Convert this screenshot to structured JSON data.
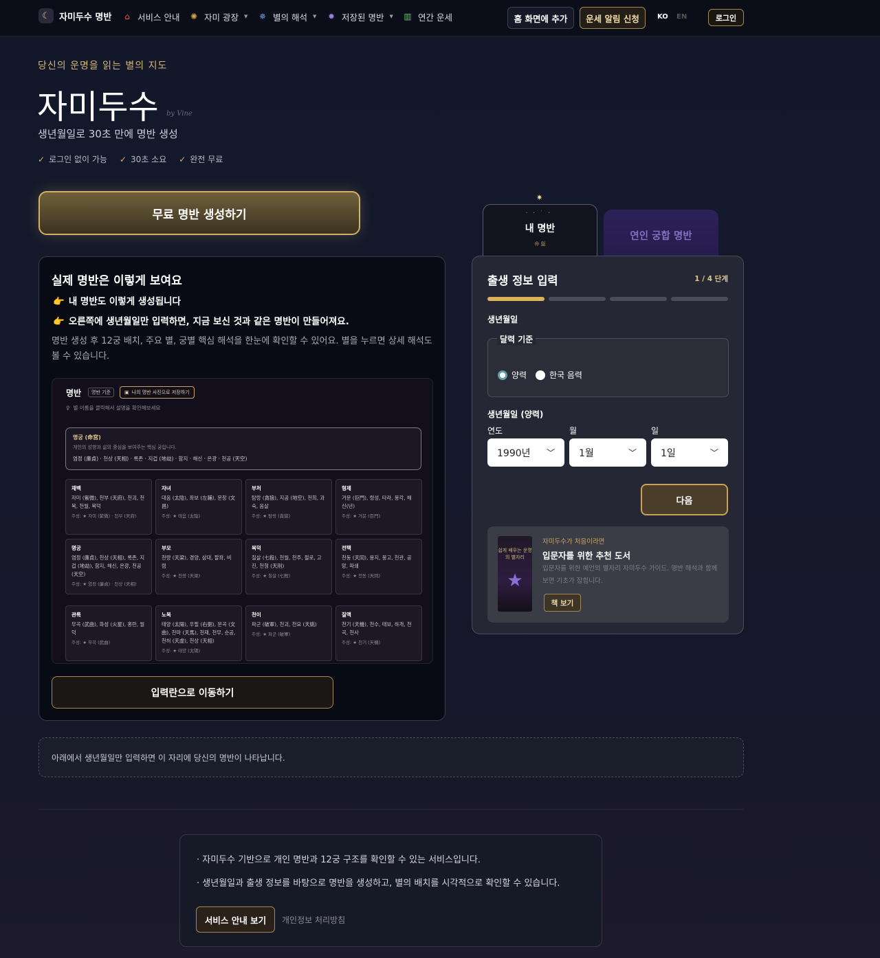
{
  "nav": {
    "logo_label": "자미두수 명반",
    "items": [
      {
        "label": "서비스 안내",
        "icon": "home-icon"
      },
      {
        "label": "자미 광장",
        "icon": "plaza-icon"
      },
      {
        "label": "별의 해석",
        "icon": "galaxy-icon"
      },
      {
        "label": "저장된 명반",
        "icon": "saved-icon"
      },
      {
        "label": "연간 운세",
        "icon": "chart-icon"
      }
    ],
    "add_home": "홈 화면에 추가",
    "alert": "운세 알림 신청",
    "lang_ko": "KO",
    "lang_en": "EN",
    "login": "로그인"
  },
  "hero": {
    "tagline": "당신의 운명을 읽는 별의 지도",
    "title": "자미두수",
    "by": "by Vine",
    "desc": "생년월일로 30초 만에 명반 생성",
    "checks": [
      "로그인 없이 가능",
      "30초 소요",
      "완전 무료"
    ],
    "cta": "무료 명반 생성하기"
  },
  "preview": {
    "title": "실제 명반은 이렇게 보여요",
    "line1": "내 명반도 이렇게 생성됩니다",
    "line2": "오른쪽에 생년월일만 입력하면, 지금 보신 것과 같은 명반이 만들어져요.",
    "line3": "명반 생성 후 12궁 배치, 주요 별, 궁별 핵심 해석을 한눈에 확인할 수 있어요. 별을 누르면 상세 해석도 볼 수 있습니다.",
    "mock": {
      "title": "명반",
      "tag1": "명반 기준",
      "tag2": "나의 명반 사진으로 저장하기",
      "hint": "별 이름을 클릭해서 설명을 확인해보세요",
      "main_name": "명궁 (命宮)",
      "main_desc": "개인의 성향과 삶의 중심을 보여주는 핵심 궁입니다.",
      "main_stars": "염정 (廉貞) · 천상 (天相) · 록존 · 지겁 (地劫) · 함지 · 해신 · 은광 · 천공 (天空)",
      "cells": [
        {
          "name": "재백",
          "stars": "자미 (紫微), 천부 (天府), 천괴, 천복, 천월, 복덕",
          "main": "주성: ★ 자미 (紫微) · 천부 (天府)"
        },
        {
          "name": "자녀",
          "stars": "대음 (太陰), 좌보 (左輔), 문창 (文昌)",
          "main": "주성: ★ 태음 (太陰)"
        },
        {
          "name": "부처",
          "stars": "탐랑 (貪狼), 지공 (地空), 천희, 과숙, 음살",
          "main": "주성: ★ 탐랑 (貪狼)"
        },
        {
          "name": "형제",
          "stars": "거문 (巨門), 령성, 타라, 봉각, 해신(년)",
          "main": "주성: ★ 거문 (巨門)"
        },
        {
          "name": "명궁",
          "stars": "염정 (廉貞), 천상 (天相), 록존, 지겁 (地劫), 함지, 해신, 은광, 천공 (天空)",
          "main": "주성: ★ 염정 (廉貞) · 천상 (天相)"
        },
        {
          "name": "부모",
          "stars": "천량 (天梁), 경양, 삼대, 팔좌, 비렴",
          "main": "주성: ★ 천량 (天梁)"
        },
        {
          "name": "복덕",
          "stars": "칠살 (七殺), 천월, 천주, 절로, 고진, 천형 (天刑)",
          "main": "주성: ★ 칠살 (七殺)"
        },
        {
          "name": "전택",
          "stars": "천동 (天同), 용지, 봉고, 천관, 공망, 파쇄",
          "main": "주성: ★ 천동 (天同)"
        },
        {
          "name": "관록",
          "stars": "무곡 (武曲), 화성 (火星), 홍란, 월덕",
          "main": "주성: ★ 무곡 (武曲)"
        },
        {
          "name": "노복",
          "stars": "태양 (太陽), 우필 (右弼), 문곡 (文曲), 천마 (天馬), 천재, 천무, 순공, 천허 (天虛), 천상 (天相)",
          "main": "주성: ★ 태양 (太陽)"
        },
        {
          "name": "천이",
          "stars": "파군 (破軍), 천괴, 천요 (天姚)",
          "main": "주성: ★ 파군 (破軍)"
        },
        {
          "name": "질액",
          "stars": "천기 (天機), 천수, 태보, 하개, 천곡, 천사",
          "main": "주성: ★ 천기 (天機)"
        }
      ]
    },
    "move_btn": "입력란으로 이동하기"
  },
  "tabs": {
    "my": "내 명반",
    "my_sub": "命 盤",
    "love": "연인 궁합 명반"
  },
  "form": {
    "title": "출생 정보 입력",
    "step": "1 / 4 단계",
    "progress": 0.25,
    "birth_label": "생년월일",
    "calendar_legend": "달력 기준",
    "solar": "양력",
    "lunar": "한국 음력",
    "date_label": "생년월일 (양력)",
    "year_label": "연도",
    "month_label": "월",
    "day_label": "일",
    "year_val": "1990년",
    "month_val": "1월",
    "day_val": "1일",
    "next": "다음"
  },
  "book": {
    "kicker": "자미두수가 처음이라면",
    "title": "입문자를 위한 추천 도서",
    "desc": "입문자를 위한 예언의 별자리 자미두수 가이드. 명반 해석과 함께 보면 기초가 잡힙니다.",
    "btn": "책 보기",
    "cover_text": "쉽게 배우는 운명의 별자리"
  },
  "notice": "아래에서 생년월일만 입력하면 이 자리에 당신의 명반이 나타납니다.",
  "footer": {
    "p1": "자미두수 기반으로 개인 명반과 12궁 구조를 확인할 수 있는 서비스입니다.",
    "p2": "생년월일과 출생 정보를 바탕으로 명반을 생성하고, 별의 배치를 시각적으로 확인할 수 있습니다.",
    "btn": "서비스 안내 보기",
    "privacy": "개인정보 처리방침"
  }
}
